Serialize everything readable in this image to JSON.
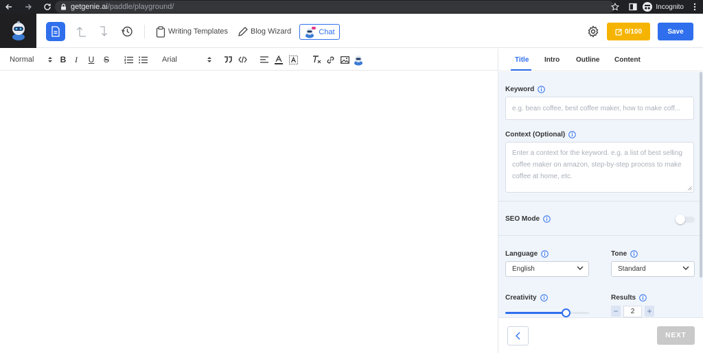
{
  "browser": {
    "url_host": "getgenie.ai",
    "url_path": "/paddle/playground/",
    "profile_label": "Incognito"
  },
  "header": {
    "writing_templates_label": "Writing Templates",
    "blog_wizard_label": "Blog Wizard",
    "chat_label": "Chat",
    "credits_label": "0/100",
    "save_label": "Save"
  },
  "toolbar": {
    "paragraph_style": "Normal",
    "font_family": "Arial",
    "bold": "B",
    "italic": "I",
    "underline": "U",
    "strike": "S",
    "clear_format": "Tx"
  },
  "panel": {
    "tabs": [
      {
        "label": "Title",
        "active": true
      },
      {
        "label": "Intro",
        "active": false
      },
      {
        "label": "Outline",
        "active": false
      },
      {
        "label": "Content",
        "active": false
      }
    ],
    "keyword": {
      "label": "Keyword",
      "placeholder": "e.g. bean coffee, best coffee maker, how to make coff..."
    },
    "context": {
      "label": "Context (Optional)",
      "placeholder": "Enter a context for the keyword. e.g. a list of best selling coffee maker on amazon, step-by-step process to make coffee at home, etc."
    },
    "seo_mode": {
      "label": "SEO Mode",
      "enabled": false
    },
    "language": {
      "label": "Language",
      "value": "English"
    },
    "tone": {
      "label": "Tone",
      "value": "Standard"
    },
    "creativity": {
      "label": "Creativity",
      "level": 0.75
    },
    "results": {
      "label": "Results",
      "value": "2",
      "minus": "−",
      "plus": "+"
    },
    "next_label": "NEXT"
  },
  "colors": {
    "accent": "#2f6fed",
    "credits": "#f6b402",
    "panel_bg": "#f0f5fc"
  }
}
